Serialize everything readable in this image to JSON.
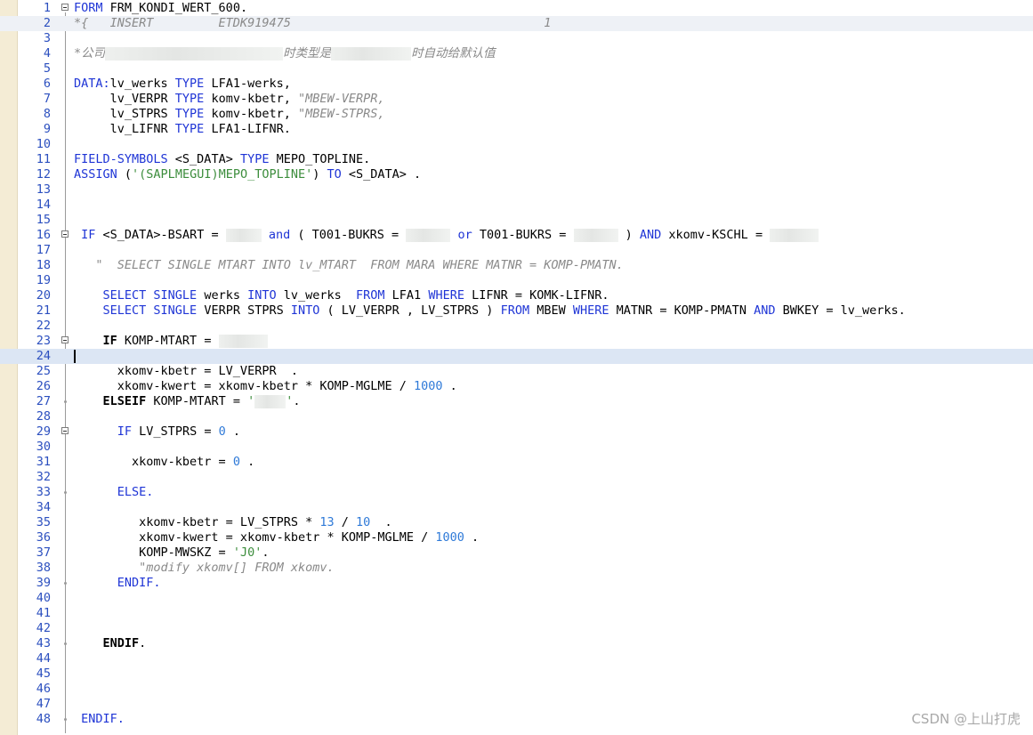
{
  "editor": {
    "watermark": "CSDN @上山打虎",
    "lines": [
      {
        "n": "1",
        "fold": "box",
        "tokens": [
          {
            "c": "kw",
            "t": "FORM"
          },
          {
            "t": " FRM_KONDI_WERT_600."
          }
        ]
      },
      {
        "n": "2",
        "fold": "none",
        "hl": "first",
        "tokens": [
          {
            "c": "cm",
            "t": "*{   INSERT         ETDK919475                                   1"
          }
        ]
      },
      {
        "n": "3",
        "tokens": []
      },
      {
        "n": "4",
        "tokens": [
          {
            "c": "cm",
            "t": "*公司"
          },
          {
            "mask": 200
          },
          {
            "c": "cm",
            "t": "时类型是"
          },
          {
            "mask": 90
          },
          {
            "c": "cm",
            "t": "时自动给默认值"
          }
        ]
      },
      {
        "n": "5",
        "tokens": []
      },
      {
        "n": "6",
        "tokens": [
          {
            "c": "kw",
            "t": "DATA:"
          },
          {
            "t": "lv_werks "
          },
          {
            "c": "kw",
            "t": "TYPE"
          },
          {
            "t": " LFA1-werks,"
          }
        ]
      },
      {
        "n": "7",
        "tokens": [
          {
            "t": "     lv_VERPR "
          },
          {
            "c": "kw",
            "t": "TYPE"
          },
          {
            "t": " komv-kbetr, "
          },
          {
            "c": "cm",
            "t": "\"MBEW-VERPR,"
          }
        ]
      },
      {
        "n": "8",
        "tokens": [
          {
            "t": "     lv_STPRS "
          },
          {
            "c": "kw",
            "t": "TYPE"
          },
          {
            "t": " komv-kbetr, "
          },
          {
            "c": "cm",
            "t": "\"MBEW-STPRS,"
          }
        ]
      },
      {
        "n": "9",
        "tokens": [
          {
            "t": "     lv_LIFNR "
          },
          {
            "c": "kw",
            "t": "TYPE"
          },
          {
            "t": " LFA1-LIFNR."
          }
        ]
      },
      {
        "n": "10",
        "tokens": []
      },
      {
        "n": "11",
        "tokens": [
          {
            "c": "kw",
            "t": "FIELD-SYMBOLS"
          },
          {
            "t": " <S_DATA> "
          },
          {
            "c": "kw",
            "t": "TYPE"
          },
          {
            "t": " MEPO_TOPLINE."
          }
        ]
      },
      {
        "n": "12",
        "tokens": [
          {
            "c": "kw",
            "t": "ASSIGN"
          },
          {
            "t": " ("
          },
          {
            "c": "st",
            "t": "'(SAPLMEGUI)MEPO_TOPLINE'"
          },
          {
            "t": ") "
          },
          {
            "c": "kw",
            "t": "TO"
          },
          {
            "t": " <S_DATA> ."
          }
        ]
      },
      {
        "n": "13",
        "tokens": []
      },
      {
        "n": "14",
        "tokens": []
      },
      {
        "n": "15",
        "tokens": []
      },
      {
        "n": "16",
        "fold": "box",
        "tokens": [
          {
            "t": " "
          },
          {
            "c": "kw",
            "t": "IF"
          },
          {
            "t": " <S_DATA>-BSART = "
          },
          {
            "mask": 40
          },
          {
            "t": " "
          },
          {
            "c": "kw",
            "t": "and"
          },
          {
            "t": " ( T001-BUKRS = "
          },
          {
            "mask": 50
          },
          {
            "t": " "
          },
          {
            "c": "kw",
            "t": "or"
          },
          {
            "t": " T001-BUKRS = "
          },
          {
            "mask": 50
          },
          {
            "t": " ) "
          },
          {
            "c": "kw",
            "t": "AND"
          },
          {
            "t": " xkomv-KSCHL = "
          },
          {
            "mask": 55
          }
        ]
      },
      {
        "n": "17",
        "tokens": []
      },
      {
        "n": "18",
        "tokens": [
          {
            "c": "cm",
            "t": "   \"  SELECT SINGLE MTART INTO lv_MTART  FROM MARA WHERE MATNR = KOMP-PMATN."
          }
        ]
      },
      {
        "n": "19",
        "tokens": []
      },
      {
        "n": "20",
        "tokens": [
          {
            "t": "    "
          },
          {
            "c": "kw",
            "t": "SELECT SINGLE"
          },
          {
            "t": " werks "
          },
          {
            "c": "kw",
            "t": "INTO"
          },
          {
            "t": " lv_werks  "
          },
          {
            "c": "kw",
            "t": "FROM"
          },
          {
            "t": " LFA1 "
          },
          {
            "c": "kw",
            "t": "WHERE"
          },
          {
            "t": " LIFNR = KOMK-LIFNR."
          }
        ]
      },
      {
        "n": "21",
        "tokens": [
          {
            "t": "    "
          },
          {
            "c": "kw",
            "t": "SELECT SINGLE"
          },
          {
            "t": " VERPR STPRS "
          },
          {
            "c": "kw",
            "t": "INTO"
          },
          {
            "t": " ( LV_VERPR , LV_STPRS ) "
          },
          {
            "c": "kw",
            "t": "FROM"
          },
          {
            "t": " MBEW "
          },
          {
            "c": "kw",
            "t": "WHERE"
          },
          {
            "t": " MATNR = KOMP-PMATN "
          },
          {
            "c": "kw",
            "t": "AND"
          },
          {
            "t": " BWKEY = lv_werks."
          }
        ]
      },
      {
        "n": "22",
        "tokens": []
      },
      {
        "n": "23",
        "fold": "box",
        "tokens": [
          {
            "t": "    "
          },
          {
            "c": "kwb",
            "t": "IF"
          },
          {
            "t": " KOMP-MTART = "
          },
          {
            "mask": 55
          }
        ]
      },
      {
        "n": "24",
        "hl": "current",
        "cursor": true,
        "tokens": []
      },
      {
        "n": "25",
        "tokens": [
          {
            "t": "      xkomv-kbetr = LV_VERPR  ."
          }
        ]
      },
      {
        "n": "26",
        "tokens": [
          {
            "t": "      xkomv-kwert = xkomv-kbetr * KOMP-MGLME / "
          },
          {
            "c": "num",
            "t": "1000"
          },
          {
            "t": " ."
          }
        ]
      },
      {
        "n": "27",
        "fold": "dot",
        "tokens": [
          {
            "t": "    "
          },
          {
            "c": "kwb",
            "t": "ELSEIF"
          },
          {
            "t": " KOMP-MTART = "
          },
          {
            "c": "st",
            "t": "'"
          },
          {
            "mask": 35
          },
          {
            "c": "st",
            "t": "'"
          },
          {
            "t": "."
          }
        ]
      },
      {
        "n": "28",
        "tokens": []
      },
      {
        "n": "29",
        "fold": "box",
        "tokens": [
          {
            "t": "      "
          },
          {
            "c": "kw",
            "t": "IF"
          },
          {
            "t": " LV_STPRS = "
          },
          {
            "c": "num",
            "t": "0"
          },
          {
            "t": " ."
          }
        ]
      },
      {
        "n": "30",
        "tokens": []
      },
      {
        "n": "31",
        "tokens": [
          {
            "t": "        xkomv-kbetr = "
          },
          {
            "c": "num",
            "t": "0"
          },
          {
            "t": " ."
          }
        ]
      },
      {
        "n": "32",
        "tokens": []
      },
      {
        "n": "33",
        "fold": "dot",
        "tokens": [
          {
            "t": "      "
          },
          {
            "c": "kw",
            "t": "ELSE."
          }
        ]
      },
      {
        "n": "34",
        "tokens": []
      },
      {
        "n": "35",
        "tokens": [
          {
            "t": "         xkomv-kbetr = LV_STPRS * "
          },
          {
            "c": "num",
            "t": "13"
          },
          {
            "t": " / "
          },
          {
            "c": "num",
            "t": "10"
          },
          {
            "t": "  ."
          }
        ]
      },
      {
        "n": "36",
        "tokens": [
          {
            "t": "         xkomv-kwert = xkomv-kbetr * KOMP-MGLME / "
          },
          {
            "c": "num",
            "t": "1000"
          },
          {
            "t": " ."
          }
        ]
      },
      {
        "n": "37",
        "tokens": [
          {
            "t": "         KOMP-MWSKZ = "
          },
          {
            "c": "st",
            "t": "'J0'"
          },
          {
            "t": "."
          }
        ]
      },
      {
        "n": "38",
        "tokens": [
          {
            "c": "cm",
            "t": "         \"modify xkomv[] FROM xkomv."
          }
        ]
      },
      {
        "n": "39",
        "fold": "dot",
        "tokens": [
          {
            "t": "      "
          },
          {
            "c": "kw",
            "t": "ENDIF."
          }
        ]
      },
      {
        "n": "40",
        "tokens": []
      },
      {
        "n": "41",
        "tokens": []
      },
      {
        "n": "42",
        "tokens": []
      },
      {
        "n": "43",
        "fold": "dot",
        "tokens": [
          {
            "t": "    "
          },
          {
            "c": "kwb",
            "t": "ENDIF"
          },
          {
            "t": "."
          }
        ]
      },
      {
        "n": "44",
        "tokens": []
      },
      {
        "n": "45",
        "tokens": []
      },
      {
        "n": "46",
        "tokens": []
      },
      {
        "n": "47",
        "tokens": []
      },
      {
        "n": "48",
        "fold": "dot",
        "tokens": [
          {
            "t": " "
          },
          {
            "c": "kw",
            "t": "ENDIF."
          }
        ]
      }
    ]
  }
}
